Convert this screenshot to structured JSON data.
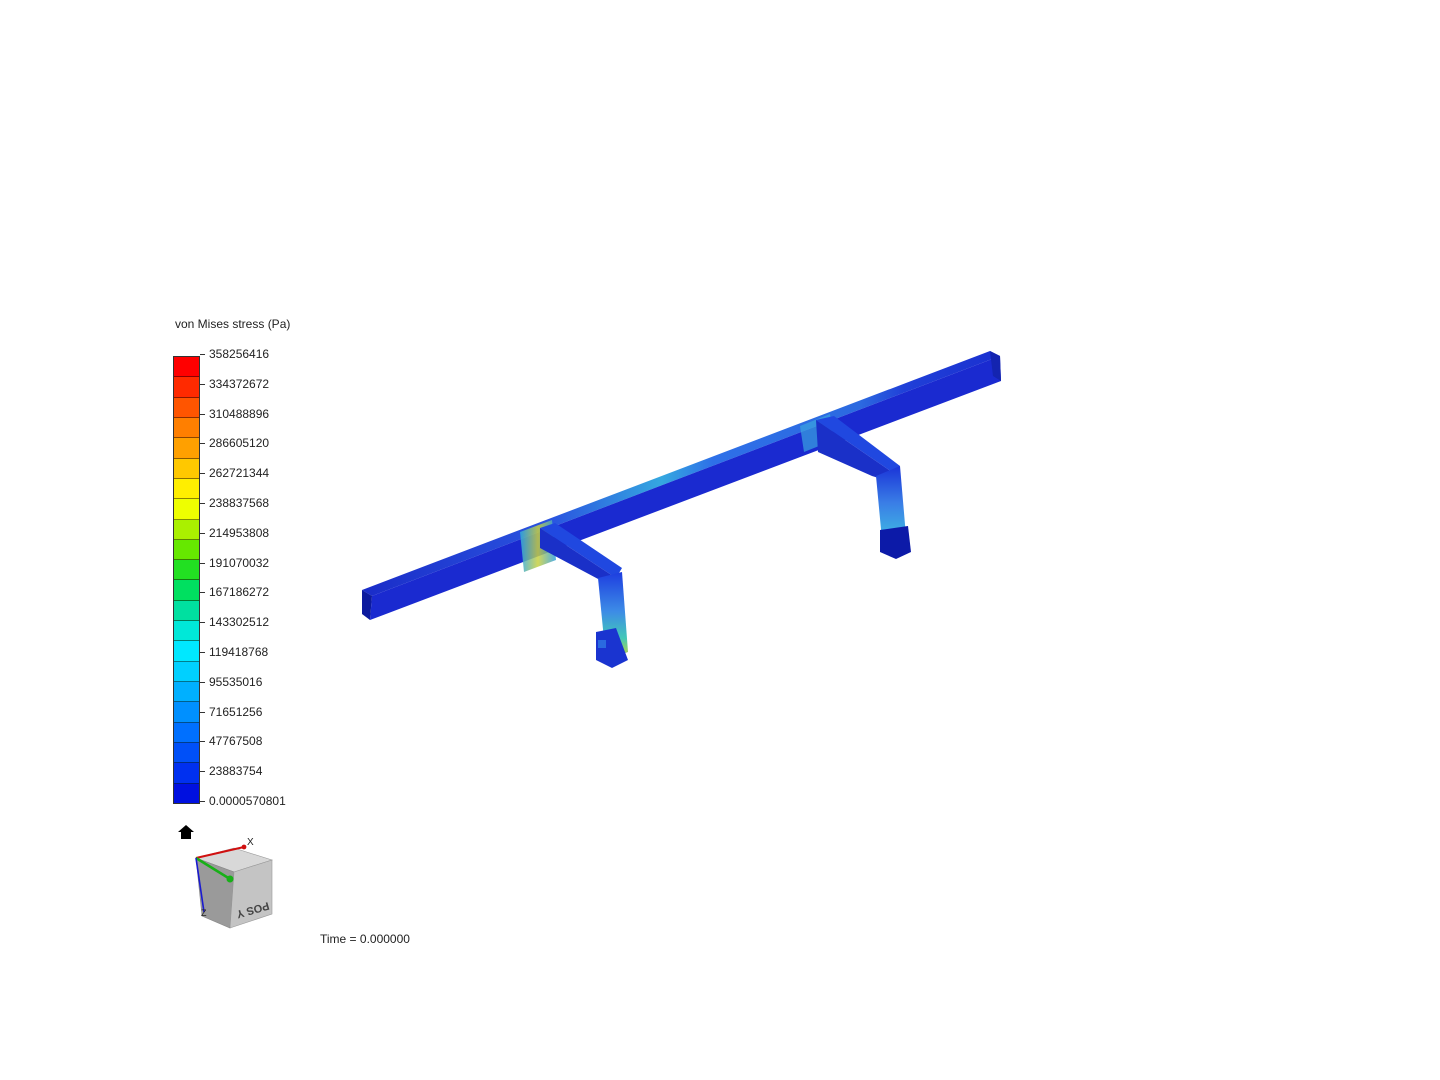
{
  "legend": {
    "title": "von Mises stress (Pa)",
    "ticks": [
      "358256416",
      "334372672",
      "310488896",
      "286605120",
      "262721344",
      "238837568",
      "214953808",
      "191070032",
      "167186272",
      "143302512",
      "119418768",
      "95535016",
      "71651256",
      "47767508",
      "23883754",
      "0.0000570801"
    ],
    "bands": [
      "#ff0000",
      "#ff2a00",
      "#ff5500",
      "#ff7f00",
      "#ffa000",
      "#ffc800",
      "#ffee00",
      "#eeff00",
      "#aaf000",
      "#66e800",
      "#22e022",
      "#00e060",
      "#00e0a0",
      "#00e8d8",
      "#00e8ff",
      "#00d0ff",
      "#00b0ff",
      "#0090ff",
      "#0070ff",
      "#0050f8",
      "#0030f0",
      "#0010e0"
    ]
  },
  "orientation": {
    "axis_x": "X",
    "axis_z": "Z",
    "face_label": "POS Y"
  },
  "status": {
    "time": "Time = 0.000000"
  },
  "colors": {
    "model_base": "#1a2fd0",
    "model_dark": "#0c1a9e",
    "stress_low": "#0010e0",
    "stress_high": "#ff0000"
  },
  "icons": {
    "home": "home-icon",
    "view_cube": "view-cube-icon"
  }
}
